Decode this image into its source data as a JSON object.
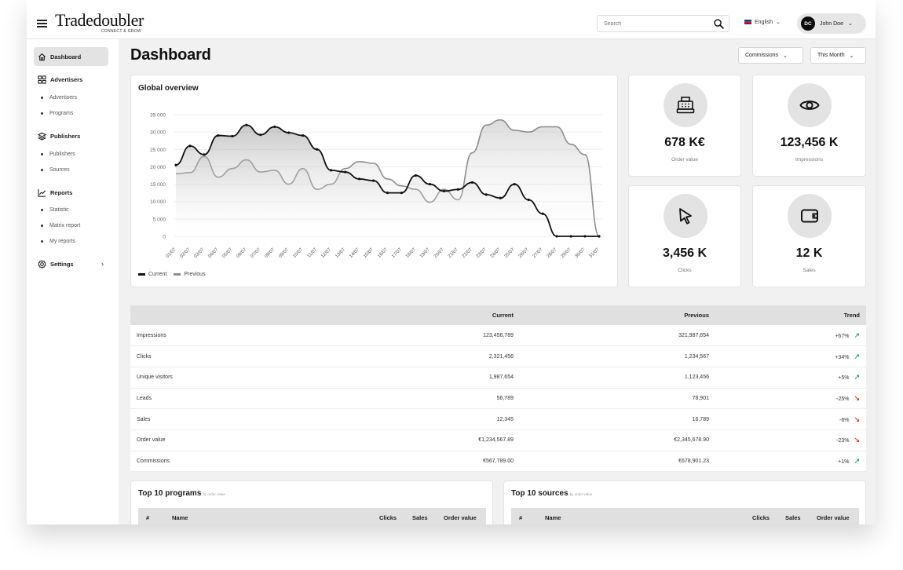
{
  "header": {
    "logo": "Tradedoubler",
    "logo_tagline": "CONNECT & GROW",
    "search_placeholder": "Search",
    "language": "English",
    "user_initials": "DC",
    "user_name": "John Doe"
  },
  "sidebar": {
    "dashboard": "Dashboard",
    "advertisers": "Advertisers",
    "advertisers_items": [
      "Advertisers",
      "Programs"
    ],
    "publishers": "Publishers",
    "publishers_items": [
      "Publishers",
      "Sources"
    ],
    "reports": "Reports",
    "reports_items": [
      "Statistic",
      "Matrix report",
      "My reports"
    ],
    "settings": "Settings"
  },
  "page": {
    "title": "Dashboard",
    "filter_metric": "Commissions",
    "filter_period": "This Month"
  },
  "overview": {
    "title": "Global overview",
    "legend_current": "Current",
    "legend_previous": "Previous"
  },
  "chart_data": {
    "type": "area",
    "title": "Global overview",
    "y_ticks": [
      "35 000",
      "30 000",
      "25 000",
      "20 000",
      "15 000",
      "10 000",
      "5 000",
      "0"
    ],
    "ylim": [
      0,
      35000
    ],
    "categories": [
      "01/07",
      "02/07",
      "03/07",
      "04/07",
      "05/07",
      "06/07",
      "07/07",
      "08/07",
      "09/07",
      "10/07",
      "11/07",
      "12/07",
      "13/07",
      "14/07",
      "15/07",
      "16/07",
      "17/07",
      "18/07",
      "19/07",
      "20/07",
      "21/07",
      "22/07",
      "23/07",
      "24/07",
      "25/07",
      "26/07",
      "27/07",
      "28/07",
      "29/07",
      "30/07",
      "31/07"
    ],
    "series": [
      {
        "name": "Current",
        "color": "#111111",
        "values": [
          20500,
          26000,
          23500,
          29000,
          28800,
          32000,
          29200,
          31500,
          29800,
          29000,
          25000,
          19000,
          18500,
          16500,
          16000,
          12500,
          12500,
          17500,
          15000,
          13000,
          13500,
          15500,
          12000,
          11000,
          15000,
          10500,
          6500,
          0,
          0,
          0,
          0
        ]
      },
      {
        "name": "Previous",
        "color": "#8d8d8d",
        "values": [
          18000,
          18300,
          23000,
          17000,
          19500,
          22000,
          18500,
          19000,
          15000,
          19500,
          13500,
          15000,
          19500,
          21500,
          21000,
          16500,
          14500,
          13500,
          9800,
          13500,
          10500,
          24000,
          32000,
          33500,
          30500,
          30000,
          31500,
          31500,
          26500,
          23500,
          0
        ]
      }
    ],
    "grid": true,
    "legend": "bottom-left"
  },
  "kpis": [
    {
      "value": "678 K€",
      "label": "Order value",
      "icon": "cash-register-icon"
    },
    {
      "value": "123,456 K",
      "label": "Impressions",
      "icon": "eye-icon"
    },
    {
      "value": "3,456 K",
      "label": "Clicks",
      "icon": "cursor-icon"
    },
    {
      "value": "12 K",
      "label": "Sales",
      "icon": "wallet-icon"
    }
  ],
  "stats": {
    "columns": [
      "",
      "Current",
      "Previous",
      "Trend"
    ],
    "rows": [
      {
        "label": "Impressions",
        "current": "123,456,789",
        "previous": "321,987,654",
        "trend": "+67%",
        "dir": "up"
      },
      {
        "label": "Clicks",
        "current": "2,321,456",
        "previous": "1,234,567",
        "trend": "+34%",
        "dir": "up"
      },
      {
        "label": "Unique visitors",
        "current": "1,987,654",
        "previous": "1,123,456",
        "trend": "+5%",
        "dir": "up"
      },
      {
        "label": "Leads",
        "current": "56,789",
        "previous": "78,901",
        "trend": "-25%",
        "dir": "down"
      },
      {
        "label": "Sales",
        "current": "12,345",
        "previous": "16,789",
        "trend": "-6%",
        "dir": "down"
      },
      {
        "label": "Order value",
        "current": "€1,234,567.89",
        "previous": "€2,345,678.90",
        "trend": "-23%",
        "dir": "down"
      },
      {
        "label": "Commissions",
        "current": "€567,789.00",
        "previous": "€678,901.23",
        "trend": "+1%",
        "dir": "up"
      }
    ]
  },
  "top_programs": {
    "title": "Top 10 programs",
    "subtitle": "by order value",
    "columns": [
      "#",
      "Name",
      "Clicks",
      "Sales",
      "Order value"
    ]
  },
  "top_sources": {
    "title": "Top 10 sources",
    "subtitle": "by order value",
    "columns": [
      "#",
      "Name",
      "Clicks",
      "Sales",
      "Order value"
    ]
  },
  "colors": {
    "accent": "#111111",
    "trend_up": "#3bb267",
    "trend_down": "#e0452f",
    "background": "#f1f1f1"
  }
}
